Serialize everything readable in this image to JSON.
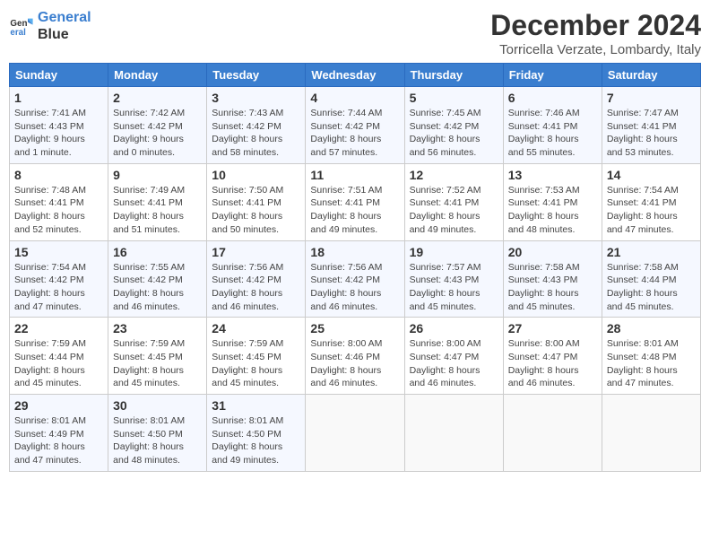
{
  "logo": {
    "line1": "General",
    "line2": "Blue"
  },
  "title": "December 2024",
  "subtitle": "Torricella Verzate, Lombardy, Italy",
  "days_of_week": [
    "Sunday",
    "Monday",
    "Tuesday",
    "Wednesday",
    "Thursday",
    "Friday",
    "Saturday"
  ],
  "weeks": [
    [
      {
        "day": "1",
        "sunrise": "7:41 AM",
        "sunset": "4:43 PM",
        "daylight": "9 hours and 1 minute."
      },
      {
        "day": "2",
        "sunrise": "7:42 AM",
        "sunset": "4:42 PM",
        "daylight": "9 hours and 0 minutes."
      },
      {
        "day": "3",
        "sunrise": "7:43 AM",
        "sunset": "4:42 PM",
        "daylight": "8 hours and 58 minutes."
      },
      {
        "day": "4",
        "sunrise": "7:44 AM",
        "sunset": "4:42 PM",
        "daylight": "8 hours and 57 minutes."
      },
      {
        "day": "5",
        "sunrise": "7:45 AM",
        "sunset": "4:42 PM",
        "daylight": "8 hours and 56 minutes."
      },
      {
        "day": "6",
        "sunrise": "7:46 AM",
        "sunset": "4:41 PM",
        "daylight": "8 hours and 55 minutes."
      },
      {
        "day": "7",
        "sunrise": "7:47 AM",
        "sunset": "4:41 PM",
        "daylight": "8 hours and 53 minutes."
      }
    ],
    [
      {
        "day": "8",
        "sunrise": "7:48 AM",
        "sunset": "4:41 PM",
        "daylight": "8 hours and 52 minutes."
      },
      {
        "day": "9",
        "sunrise": "7:49 AM",
        "sunset": "4:41 PM",
        "daylight": "8 hours and 51 minutes."
      },
      {
        "day": "10",
        "sunrise": "7:50 AM",
        "sunset": "4:41 PM",
        "daylight": "8 hours and 50 minutes."
      },
      {
        "day": "11",
        "sunrise": "7:51 AM",
        "sunset": "4:41 PM",
        "daylight": "8 hours and 49 minutes."
      },
      {
        "day": "12",
        "sunrise": "7:52 AM",
        "sunset": "4:41 PM",
        "daylight": "8 hours and 49 minutes."
      },
      {
        "day": "13",
        "sunrise": "7:53 AM",
        "sunset": "4:41 PM",
        "daylight": "8 hours and 48 minutes."
      },
      {
        "day": "14",
        "sunrise": "7:54 AM",
        "sunset": "4:41 PM",
        "daylight": "8 hours and 47 minutes."
      }
    ],
    [
      {
        "day": "15",
        "sunrise": "7:54 AM",
        "sunset": "4:42 PM",
        "daylight": "8 hours and 47 minutes."
      },
      {
        "day": "16",
        "sunrise": "7:55 AM",
        "sunset": "4:42 PM",
        "daylight": "8 hours and 46 minutes."
      },
      {
        "day": "17",
        "sunrise": "7:56 AM",
        "sunset": "4:42 PM",
        "daylight": "8 hours and 46 minutes."
      },
      {
        "day": "18",
        "sunrise": "7:56 AM",
        "sunset": "4:42 PM",
        "daylight": "8 hours and 46 minutes."
      },
      {
        "day": "19",
        "sunrise": "7:57 AM",
        "sunset": "4:43 PM",
        "daylight": "8 hours and 45 minutes."
      },
      {
        "day": "20",
        "sunrise": "7:58 AM",
        "sunset": "4:43 PM",
        "daylight": "8 hours and 45 minutes."
      },
      {
        "day": "21",
        "sunrise": "7:58 AM",
        "sunset": "4:44 PM",
        "daylight": "8 hours and 45 minutes."
      }
    ],
    [
      {
        "day": "22",
        "sunrise": "7:59 AM",
        "sunset": "4:44 PM",
        "daylight": "8 hours and 45 minutes."
      },
      {
        "day": "23",
        "sunrise": "7:59 AM",
        "sunset": "4:45 PM",
        "daylight": "8 hours and 45 minutes."
      },
      {
        "day": "24",
        "sunrise": "7:59 AM",
        "sunset": "4:45 PM",
        "daylight": "8 hours and 45 minutes."
      },
      {
        "day": "25",
        "sunrise": "8:00 AM",
        "sunset": "4:46 PM",
        "daylight": "8 hours and 46 minutes."
      },
      {
        "day": "26",
        "sunrise": "8:00 AM",
        "sunset": "4:47 PM",
        "daylight": "8 hours and 46 minutes."
      },
      {
        "day": "27",
        "sunrise": "8:00 AM",
        "sunset": "4:47 PM",
        "daylight": "8 hours and 46 minutes."
      },
      {
        "day": "28",
        "sunrise": "8:01 AM",
        "sunset": "4:48 PM",
        "daylight": "8 hours and 47 minutes."
      }
    ],
    [
      {
        "day": "29",
        "sunrise": "8:01 AM",
        "sunset": "4:49 PM",
        "daylight": "8 hours and 47 minutes."
      },
      {
        "day": "30",
        "sunrise": "8:01 AM",
        "sunset": "4:50 PM",
        "daylight": "8 hours and 48 minutes."
      },
      {
        "day": "31",
        "sunrise": "8:01 AM",
        "sunset": "4:50 PM",
        "daylight": "8 hours and 49 minutes."
      },
      null,
      null,
      null,
      null
    ]
  ]
}
